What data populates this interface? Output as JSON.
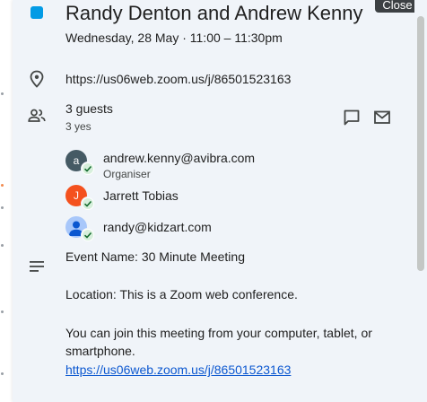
{
  "event": {
    "title": "Randy Denton and Andrew Kenny",
    "datetime": "Wednesday, 28 May  ·  11:00 – 11:30pm",
    "color": "#039be5",
    "close_label": "Close",
    "conference_link": "https://us06web.zoom.us/j/86501523163"
  },
  "guests": {
    "title": "3 guests",
    "summary": "3 yes",
    "list": [
      {
        "name": "andrew.kenny@avibra.com",
        "role": "Organiser",
        "initial": "a",
        "color": "#455a64"
      },
      {
        "name": "Jarrett Tobias",
        "role": "",
        "initial": "J",
        "color": "#f4511e"
      },
      {
        "name": "randy@kidzart.com",
        "role": "",
        "initial": "",
        "color": "#a8c7fa"
      }
    ]
  },
  "description": {
    "line1": "Event Name: 30 Minute Meeting",
    "line2": "Location: This is a Zoom web conference.",
    "line3": "You can join this meeting from your computer, tablet, or smartphone.",
    "link": "https://us06web.zoom.us/j/86501523163"
  },
  "icons": {
    "location": "location-pin-icon",
    "guests": "people-icon",
    "description": "notes-lines-icon",
    "message": "chat-bubble-icon",
    "email": "mail-icon"
  }
}
